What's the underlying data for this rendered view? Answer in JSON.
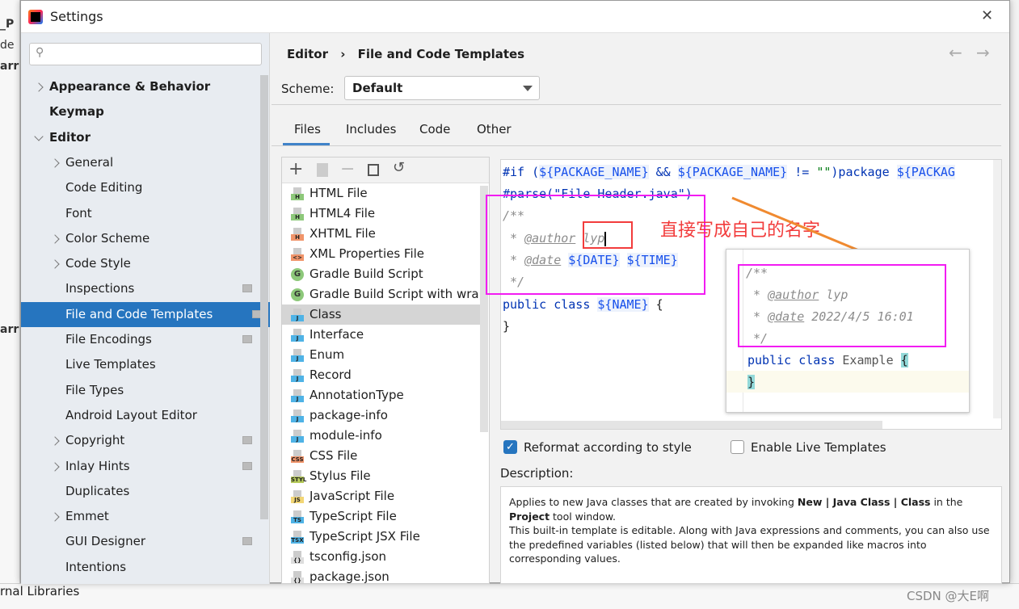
{
  "background": {
    "side_text": [
      "_P",
      "de",
      "arr",
      "arr"
    ],
    "bottom_text": "rnal Libraries",
    "watermark": "CSDN @大E啊"
  },
  "window": {
    "title": "Settings",
    "close": "✕"
  },
  "search": {
    "placeholder": ""
  },
  "sidebar": {
    "items": [
      {
        "label": "Appearance & Behavior",
        "bold": true,
        "chevron": "right",
        "indent": 0
      },
      {
        "label": "Keymap",
        "bold": true,
        "indent": 0
      },
      {
        "label": "Editor",
        "bold": true,
        "chevron": "down",
        "indent": 0
      },
      {
        "label": "General",
        "chevron": "right",
        "indent": 1
      },
      {
        "label": "Code Editing",
        "indent": 1
      },
      {
        "label": "Font",
        "indent": 1
      },
      {
        "label": "Color Scheme",
        "chevron": "right",
        "indent": 1
      },
      {
        "label": "Code Style",
        "chevron": "right",
        "indent": 1
      },
      {
        "label": "Inspections",
        "indent": 1,
        "project_icon": true
      },
      {
        "label": "File and Code Templates",
        "indent": 1,
        "selected": true,
        "project_icon": true
      },
      {
        "label": "File Encodings",
        "indent": 1,
        "project_icon": true
      },
      {
        "label": "Live Templates",
        "indent": 1
      },
      {
        "label": "File Types",
        "indent": 1
      },
      {
        "label": "Android Layout Editor",
        "indent": 1
      },
      {
        "label": "Copyright",
        "chevron": "right",
        "indent": 1,
        "project_icon": true
      },
      {
        "label": "Inlay Hints",
        "chevron": "right",
        "indent": 1,
        "project_icon": true
      },
      {
        "label": "Duplicates",
        "indent": 1
      },
      {
        "label": "Emmet",
        "chevron": "right",
        "indent": 1
      },
      {
        "label": "GUI Designer",
        "indent": 1,
        "project_icon": true
      },
      {
        "label": "Intentions",
        "indent": 1
      }
    ]
  },
  "breadcrumb": {
    "parent": "Editor",
    "sep": "›",
    "current": "File and Code Templates"
  },
  "scheme": {
    "label": "Scheme:",
    "value": "Default"
  },
  "tabs": [
    {
      "label": "Files",
      "active": true
    },
    {
      "label": "Includes"
    },
    {
      "label": "Code"
    },
    {
      "label": "Other"
    }
  ],
  "toolbar": {
    "add": "+",
    "remove": "−"
  },
  "templates": [
    {
      "label": "HTML File",
      "icon": "H",
      "color": "#8dc87a"
    },
    {
      "label": "HTML4 File",
      "icon": "H",
      "color": "#8dc87a"
    },
    {
      "label": "XHTML File",
      "icon": "H",
      "color": "#f0946a"
    },
    {
      "label": "XML Properties File",
      "icon": "<>",
      "color": "#f0946a"
    },
    {
      "label": "Gradle Build Script",
      "icon": "G",
      "gradle": true
    },
    {
      "label": "Gradle Build Script with wrapper",
      "icon": "G",
      "gradle": true
    },
    {
      "label": "Class",
      "icon": "J",
      "color": "#4fb3e6",
      "selected": true
    },
    {
      "label": "Interface",
      "icon": "J",
      "color": "#4fb3e6"
    },
    {
      "label": "Enum",
      "icon": "J",
      "color": "#4fb3e6"
    },
    {
      "label": "Record",
      "icon": "J",
      "color": "#4fb3e6"
    },
    {
      "label": "AnnotationType",
      "icon": "J",
      "color": "#4fb3e6"
    },
    {
      "label": "package-info",
      "icon": "J",
      "color": "#4fb3e6"
    },
    {
      "label": "module-info",
      "icon": "J",
      "color": "#4fb3e6"
    },
    {
      "label": "CSS File",
      "icon": "CSS",
      "color": "#f0946a"
    },
    {
      "label": "Stylus File",
      "icon": "STYL",
      "color": "#b5c95a"
    },
    {
      "label": "JavaScript File",
      "icon": "JS",
      "color": "#f2d675"
    },
    {
      "label": "TypeScript File",
      "icon": "TS",
      "color": "#4fb3e6"
    },
    {
      "label": "TypeScript JSX File",
      "icon": "TSX",
      "color": "#4fb3e6"
    },
    {
      "label": "tsconfig.json",
      "icon": "{}",
      "color": "#ddd"
    },
    {
      "label": "package.json",
      "icon": "{}",
      "color": "#ddd"
    }
  ],
  "code": {
    "l1a": "#if (",
    "l1v1": "${PACKAGE_NAME}",
    "l1b": " && ",
    "l1v2": "${PACKAGE_NAME}",
    "l1c": " != ",
    "l1s": "\"\"",
    "l1d": ")package ",
    "l1v3": "${PACKAG",
    "l2": "#parse(\"File Header.java\")",
    "l3": "/**",
    "l4a": " * ",
    "l4t": "@author",
    "l4b": " lyp",
    "l5a": " * ",
    "l5t": "@date",
    "l5b": " ",
    "l5v1": "${DATE}",
    "l5v2": "${TIME}",
    "l6": " */",
    "l7k": "public class ",
    "l7v": "${NAME}",
    "l7b": " {",
    "l8": "}"
  },
  "annotation": {
    "text": "直接写成自己的名字",
    "color": "#f23c3c",
    "arrow_color": "#f08a30",
    "box_color": "#f21cf2"
  },
  "preview": {
    "l1": "/**",
    "l2a": " * ",
    "l2t": "@author",
    "l2b": " lyp",
    "l3a": " * ",
    "l3t": "@date",
    "l3b": " 2022/4/5 16:01",
    "l4": " */",
    "l5k": "public class ",
    "l5n": "Example ",
    "l5b": "{",
    "l6": "}"
  },
  "options": {
    "reformat": {
      "label": "Reformat according to style",
      "checked": true
    },
    "live": {
      "label": "Enable Live Templates",
      "checked": false
    }
  },
  "description": {
    "label": "Description:",
    "p1a": "Applies to new Java classes that are created by invoking ",
    "p1b": "New | Java Class | Class",
    "p1c": " in the ",
    "p1d": "Project",
    "p1e": " tool window.",
    "p2": "This built-in template is editable. Along with Java expressions and comments, you can also use the predefined variables (listed below) that will then be expanded like macros into corresponding values."
  },
  "nav": {
    "back": "←",
    "forward": "→"
  }
}
